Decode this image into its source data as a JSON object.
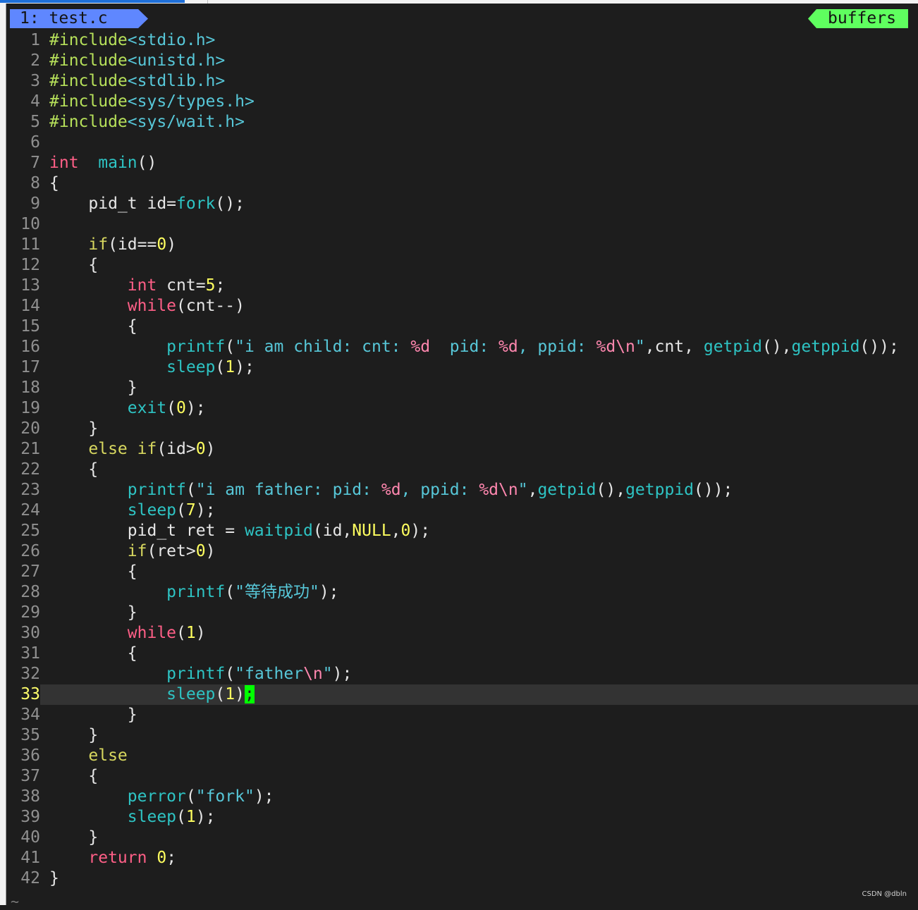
{
  "tabline": {
    "buffer_tab": "1: test.c",
    "buffers_label": "buffers"
  },
  "cursor_line": 33,
  "colors": {
    "background": "#1d1d1d",
    "tab_active": "#5f87ff",
    "buffers_label": "#5fff5f",
    "line_number": "#909090",
    "current_line_number": "#ffff6b",
    "cursor": "#00ff00",
    "preprocessor": "#b6e05a",
    "type": "#ff5f87",
    "keyword": "#d7d75f",
    "function": "#2ec4c4",
    "number": "#ffff5f",
    "string": "#57c7d8",
    "format_specifier": "#ff87af"
  },
  "code_lines": [
    {
      "n": "1",
      "t": [
        [
          "inc",
          "#include"
        ],
        [
          "hdr",
          "<stdio.h>"
        ]
      ]
    },
    {
      "n": "2",
      "t": [
        [
          "inc",
          "#include"
        ],
        [
          "hdr",
          "<unistd.h>"
        ]
      ]
    },
    {
      "n": "3",
      "t": [
        [
          "inc",
          "#include"
        ],
        [
          "hdr",
          "<stdlib.h>"
        ]
      ]
    },
    {
      "n": "4",
      "t": [
        [
          "inc",
          "#include"
        ],
        [
          "hdr",
          "<sys/types.h>"
        ]
      ]
    },
    {
      "n": "5",
      "t": [
        [
          "inc",
          "#include"
        ],
        [
          "hdr",
          "<sys/wait.h>"
        ]
      ]
    },
    {
      "n": "6",
      "t": []
    },
    {
      "n": "7",
      "t": [
        [
          "typ",
          "int"
        ],
        [
          "",
          "  "
        ],
        [
          "fn",
          "main"
        ],
        [
          "",
          "()"
        ]
      ]
    },
    {
      "n": "8",
      "t": [
        [
          "",
          "{"
        ]
      ]
    },
    {
      "n": "9",
      "t": [
        [
          "",
          "    pid_t id="
        ],
        [
          "fn",
          "fork"
        ],
        [
          "",
          "();"
        ]
      ]
    },
    {
      "n": "10",
      "t": []
    },
    {
      "n": "11",
      "t": [
        [
          "",
          "    "
        ],
        [
          "kw",
          "if"
        ],
        [
          "",
          "(id=="
        ],
        [
          "num",
          "0"
        ],
        [
          "",
          ")"
        ]
      ]
    },
    {
      "n": "12",
      "t": [
        [
          "",
          "    {"
        ]
      ]
    },
    {
      "n": "13",
      "t": [
        [
          "",
          "        "
        ],
        [
          "typ",
          "int"
        ],
        [
          "",
          " cnt="
        ],
        [
          "num",
          "5"
        ],
        [
          "",
          ";"
        ]
      ]
    },
    {
      "n": "14",
      "t": [
        [
          "",
          "        "
        ],
        [
          "typ",
          "while"
        ],
        [
          "",
          "(cnt--)"
        ]
      ]
    },
    {
      "n": "15",
      "t": [
        [
          "",
          "        {"
        ]
      ]
    },
    {
      "n": "16",
      "t": [
        [
          "",
          "            "
        ],
        [
          "fn",
          "printf"
        ],
        [
          "",
          "("
        ],
        [
          "str",
          "\"i am child: cnt: "
        ],
        [
          "spc",
          "%d"
        ],
        [
          "str",
          "  pid: "
        ],
        [
          "spc",
          "%d"
        ],
        [
          "str",
          ", ppid: "
        ],
        [
          "spc",
          "%d\\n"
        ],
        [
          "str",
          "\""
        ],
        [
          "",
          ",cnt, "
        ],
        [
          "fn",
          "getpid"
        ],
        [
          "",
          "(),"
        ],
        [
          "fn",
          "getppid"
        ],
        [
          "",
          "());"
        ]
      ]
    },
    {
      "n": "17",
      "t": [
        [
          "",
          "            "
        ],
        [
          "fn",
          "sleep"
        ],
        [
          "",
          "("
        ],
        [
          "num",
          "1"
        ],
        [
          "",
          ");"
        ]
      ]
    },
    {
      "n": "18",
      "t": [
        [
          "",
          "        }"
        ]
      ]
    },
    {
      "n": "19",
      "t": [
        [
          "",
          "        "
        ],
        [
          "fn",
          "exit"
        ],
        [
          "",
          "("
        ],
        [
          "num",
          "0"
        ],
        [
          "",
          ");"
        ]
      ]
    },
    {
      "n": "20",
      "t": [
        [
          "",
          "    }"
        ]
      ]
    },
    {
      "n": "21",
      "t": [
        [
          "",
          "    "
        ],
        [
          "kw",
          "else if"
        ],
        [
          "",
          "(id>"
        ],
        [
          "num",
          "0"
        ],
        [
          "",
          ")"
        ]
      ]
    },
    {
      "n": "22",
      "t": [
        [
          "",
          "    {"
        ]
      ]
    },
    {
      "n": "23",
      "t": [
        [
          "",
          "        "
        ],
        [
          "fn",
          "printf"
        ],
        [
          "",
          "("
        ],
        [
          "str",
          "\"i am father: pid: "
        ],
        [
          "spc",
          "%d"
        ],
        [
          "str",
          ", ppid: "
        ],
        [
          "spc",
          "%d\\n"
        ],
        [
          "str",
          "\""
        ],
        [
          "",
          ","
        ],
        [
          "fn",
          "getpid"
        ],
        [
          "",
          "(),"
        ],
        [
          "fn",
          "getppid"
        ],
        [
          "",
          "());"
        ]
      ]
    },
    {
      "n": "24",
      "t": [
        [
          "",
          "        "
        ],
        [
          "fn",
          "sleep"
        ],
        [
          "",
          "("
        ],
        [
          "num",
          "7"
        ],
        [
          "",
          ");"
        ]
      ]
    },
    {
      "n": "25",
      "t": [
        [
          "",
          "        pid_t ret = "
        ],
        [
          "fn",
          "waitpid"
        ],
        [
          "",
          "(id,"
        ],
        [
          "num",
          "NULL"
        ],
        [
          "",
          ","
        ],
        [
          "num",
          "0"
        ],
        [
          "",
          ");"
        ]
      ]
    },
    {
      "n": "26",
      "t": [
        [
          "",
          "        "
        ],
        [
          "kw",
          "if"
        ],
        [
          "",
          "(ret>"
        ],
        [
          "num",
          "0"
        ],
        [
          "",
          ")"
        ]
      ]
    },
    {
      "n": "27",
      "t": [
        [
          "",
          "        {"
        ]
      ]
    },
    {
      "n": "28",
      "t": [
        [
          "",
          "            "
        ],
        [
          "fn",
          "printf"
        ],
        [
          "",
          "("
        ],
        [
          "str",
          "\"等待成功\""
        ],
        [
          "",
          ");"
        ]
      ]
    },
    {
      "n": "29",
      "t": [
        [
          "",
          "        }"
        ]
      ]
    },
    {
      "n": "30",
      "t": [
        [
          "",
          "        "
        ],
        [
          "typ",
          "while"
        ],
        [
          "",
          "("
        ],
        [
          "num",
          "1"
        ],
        [
          "",
          ")"
        ]
      ]
    },
    {
      "n": "31",
      "t": [
        [
          "",
          "        {"
        ]
      ]
    },
    {
      "n": "32",
      "t": [
        [
          "",
          "            "
        ],
        [
          "fn",
          "printf"
        ],
        [
          "",
          "("
        ],
        [
          "str",
          "\"father"
        ],
        [
          "spc",
          "\\n"
        ],
        [
          "str",
          "\""
        ],
        [
          "",
          ");"
        ]
      ]
    },
    {
      "n": "33",
      "t": [
        [
          "",
          "            "
        ],
        [
          "fn",
          "sleep"
        ],
        [
          "",
          "("
        ],
        [
          "num",
          "1"
        ],
        [
          "",
          ")"
        ],
        [
          "cursor",
          ";"
        ]
      ]
    },
    {
      "n": "34",
      "t": [
        [
          "",
          "        }"
        ]
      ]
    },
    {
      "n": "35",
      "t": [
        [
          "",
          "    }"
        ]
      ]
    },
    {
      "n": "36",
      "t": [
        [
          "",
          "    "
        ],
        [
          "kw",
          "else"
        ]
      ]
    },
    {
      "n": "37",
      "t": [
        [
          "",
          "    {"
        ]
      ]
    },
    {
      "n": "38",
      "t": [
        [
          "",
          "        "
        ],
        [
          "fn",
          "perror"
        ],
        [
          "",
          "("
        ],
        [
          "str",
          "\"fork\""
        ],
        [
          "",
          ");"
        ]
      ]
    },
    {
      "n": "39",
      "t": [
        [
          "",
          "        "
        ],
        [
          "fn",
          "sleep"
        ],
        [
          "",
          "("
        ],
        [
          "num",
          "1"
        ],
        [
          "",
          ");"
        ]
      ]
    },
    {
      "n": "40",
      "t": [
        [
          "",
          "    }"
        ]
      ]
    },
    {
      "n": "41",
      "t": [
        [
          "",
          "    "
        ],
        [
          "typ",
          "return"
        ],
        [
          "",
          " "
        ],
        [
          "num",
          "0"
        ],
        [
          "",
          ";"
        ]
      ]
    },
    {
      "n": "42",
      "t": [
        [
          "",
          "}"
        ]
      ]
    }
  ],
  "empty_line_marker": "~",
  "watermark": "CSDN @dbln"
}
